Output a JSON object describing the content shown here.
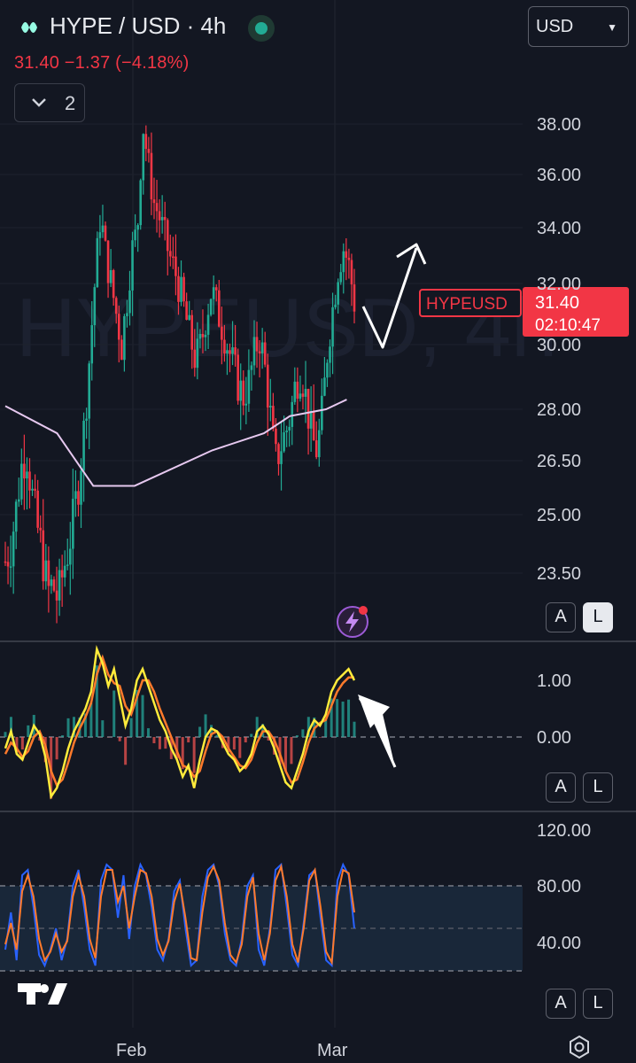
{
  "header": {
    "symbol": "HYPE / USD · 4h",
    "quote_line": "31.40  −1.37 (−4.18%)",
    "currency_select": "USD",
    "collapse_count": "2"
  },
  "watermark": "HYPEUSD, 4h",
  "price_label": {
    "name": "HYPEUSD",
    "price": "31.40",
    "countdown": "02:10:47"
  },
  "scale_buttons": {
    "auto": "A",
    "log": "L"
  },
  "colors": {
    "background": "#131722",
    "up": "#22ab94",
    "down": "#f23645",
    "ma": "#e6c8ef",
    "macd_line": "#ffeb3b",
    "signal_line": "#ff7a2b",
    "stoch_k": "#2962ff",
    "stoch_d": "#ff7a2b"
  },
  "chart_data": [
    {
      "type": "candlestick",
      "pane": "price",
      "y_ticks": [
        "38.00",
        "36.00",
        "34.00",
        "32.00",
        "30.00",
        "28.00",
        "26.50",
        "25.00",
        "23.50"
      ],
      "ylim": [
        22.5,
        39
      ],
      "x_ticks": [
        "Feb",
        "Mar"
      ],
      "series": [
        {
          "name": "HYPEUSD",
          "close_path": [
            23.8,
            24.2,
            25.1,
            26.3,
            26.8,
            25.6,
            24.7,
            24.0,
            23.0,
            23.2,
            22.8,
            23.6,
            24.2,
            25.0,
            26.1,
            27.6,
            29.8,
            32.2,
            34.5,
            33.0,
            32.0,
            31.0,
            30.0,
            31.5,
            33.2,
            34.0,
            38.0,
            36.5,
            35.0,
            34.5,
            33.8,
            33.0,
            32.5,
            31.8,
            31.0,
            30.2,
            29.5,
            30.0,
            31.0,
            31.8,
            31.2,
            30.6,
            30.0,
            29.4,
            28.8,
            28.4,
            28.8,
            29.6,
            30.3,
            29.4,
            28.0,
            26.4,
            26.9,
            27.3,
            27.9,
            28.9,
            29.2,
            28.2,
            27.1,
            26.8,
            28.0,
            30.0,
            31.3,
            32.6,
            33.3,
            32.6,
            31.4
          ]
        },
        {
          "name": "Moving average",
          "points": [
            [
              0,
              28.1
            ],
            [
              0.1,
              27.3
            ],
            [
              0.17,
              25.8
            ],
            [
              0.25,
              25.8
            ],
            [
              0.4,
              26.8
            ],
            [
              0.5,
              27.3
            ],
            [
              0.55,
              27.8
            ],
            [
              0.62,
              28.0
            ],
            [
              0.66,
              28.3
            ]
          ]
        }
      ]
    },
    {
      "type": "line",
      "pane": "oscillator",
      "y_ticks": [
        "1.00",
        "0.00"
      ],
      "ylim": [
        -1.1,
        1.6
      ],
      "series": [
        {
          "name": "",
          "values": [
            -0.2,
            0.1,
            -0.3,
            -0.4,
            -0.1,
            0.2,
            0.05,
            -0.35,
            -1.05,
            -0.9,
            -0.6,
            -0.2,
            0.1,
            0.3,
            0.5,
            0.8,
            1.55,
            1.3,
            0.9,
            1.2,
            0.7,
            0.2,
            0.5,
            1.0,
            1.2,
            0.9,
            0.6,
            0.3,
            0.1,
            -0.2,
            -0.4,
            -0.7,
            -0.5,
            -0.9,
            -0.4,
            0.0,
            0.15,
            0.1,
            -0.1,
            -0.3,
            -0.4,
            -0.6,
            -0.5,
            -0.3,
            0.1,
            0.2,
            0.05,
            -0.2,
            -0.5,
            -0.8,
            -0.9,
            -0.6,
            -0.3,
            0.1,
            0.3,
            0.2,
            0.4,
            0.8,
            1.0,
            1.1,
            1.2,
            1.0
          ]
        },
        {
          "name": "",
          "values": [
            -0.3,
            -0.1,
            -0.2,
            -0.35,
            -0.25,
            0.0,
            0.1,
            -0.15,
            -0.6,
            -0.85,
            -0.75,
            -0.45,
            -0.1,
            0.15,
            0.35,
            0.6,
            1.1,
            1.4,
            1.1,
            0.95,
            0.9,
            0.55,
            0.4,
            0.7,
            1.0,
            1.0,
            0.8,
            0.5,
            0.25,
            0.0,
            -0.25,
            -0.5,
            -0.55,
            -0.7,
            -0.6,
            -0.25,
            0.05,
            0.1,
            0.0,
            -0.2,
            -0.35,
            -0.5,
            -0.55,
            -0.4,
            -0.1,
            0.1,
            0.1,
            -0.05,
            -0.3,
            -0.6,
            -0.8,
            -0.75,
            -0.45,
            -0.1,
            0.15,
            0.25,
            0.3,
            0.55,
            0.8,
            0.95,
            1.05,
            1.05
          ]
        }
      ]
    },
    {
      "type": "line",
      "pane": "stochastic",
      "y_ticks": [
        "120.00",
        "80.00",
        "40.00"
      ],
      "band": [
        20,
        80
      ],
      "ylim": [
        -5,
        125
      ],
      "series": [
        {
          "name": "",
          "values": [
            20,
            55,
            10,
            90,
            95,
            60,
            15,
            5,
            20,
            40,
            10,
            30,
            80,
            95,
            60,
            20,
            5,
            85,
            100,
            95,
            50,
            90,
            30,
            80,
            100,
            90,
            60,
            20,
            10,
            30,
            75,
            85,
            40,
            5,
            10,
            70,
            95,
            100,
            80,
            35,
            10,
            5,
            30,
            80,
            90,
            20,
            5,
            40,
            95,
            100,
            60,
            15,
            5,
            45,
            90,
            95,
            50,
            10,
            5,
            85,
            100,
            90,
            40
          ]
        },
        {
          "name": "",
          "values": [
            25,
            45,
            20,
            75,
            90,
            70,
            30,
            10,
            18,
            35,
            18,
            28,
            70,
            90,
            70,
            30,
            12,
            70,
            95,
            95,
            65,
            80,
            40,
            70,
            95,
            92,
            70,
            30,
            15,
            28,
            65,
            82,
            50,
            12,
            10,
            55,
            88,
            98,
            85,
            45,
            15,
            8,
            25,
            70,
            88,
            35,
            10,
            35,
            85,
            98,
            70,
            25,
            8,
            40,
            85,
            95,
            60,
            18,
            8,
            70,
            95,
            92,
            55
          ]
        }
      ]
    }
  ]
}
